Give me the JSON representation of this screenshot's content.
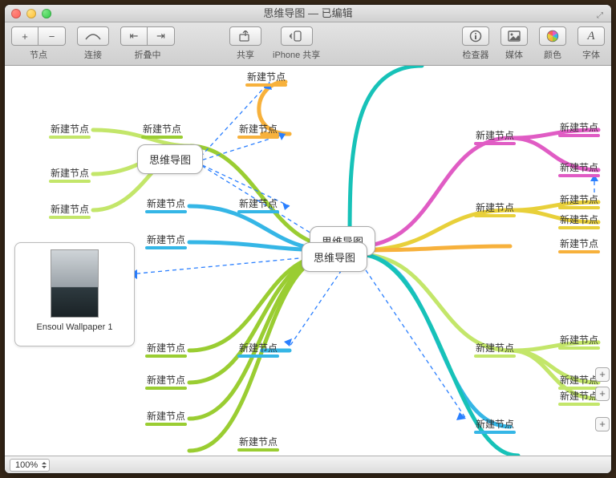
{
  "window": {
    "title": "思维导图 — 已编辑"
  },
  "toolbar": {
    "node_group": "节点",
    "connect": "连接",
    "fold": "折叠中",
    "share": "共享",
    "iphone_share": "iPhone 共享",
    "inspector": "检查器",
    "media": "媒体",
    "color": "颜色",
    "font": "字体"
  },
  "map": {
    "center_main": "思维导图",
    "center_back": "思维导图",
    "center_aux": "思维导图",
    "node_label": "新建节点",
    "image_caption": "Ensoul Wallpaper 1"
  },
  "status": {
    "zoom": "100%"
  },
  "colors": {
    "green": "#9acd32",
    "lime": "#c3e66a",
    "orange": "#f7b13c",
    "cyan": "#3ad1c9",
    "skyblue": "#35b6e6",
    "magenta": "#e05cc4",
    "yellow": "#e8d03a",
    "teal": "#17c2b8"
  }
}
